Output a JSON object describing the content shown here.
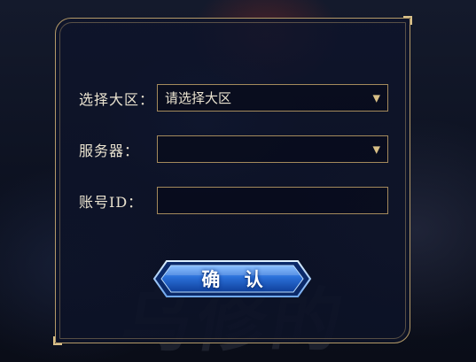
{
  "form": {
    "server_region": {
      "label": "选择大区：",
      "value": "请选择大区",
      "icon": "chevron-down-icon"
    },
    "server": {
      "label": "服务器：",
      "value": "",
      "icon": "chevron-down-icon"
    },
    "account": {
      "label": "账号ID：",
      "value": "",
      "placeholder": ""
    },
    "confirm_label": "确 认"
  },
  "colors": {
    "gold_border": "#b49a68",
    "panel_bg": "#0e142a",
    "label_text": "#e9e2cf",
    "button_blue": "#1f5fc8"
  }
}
